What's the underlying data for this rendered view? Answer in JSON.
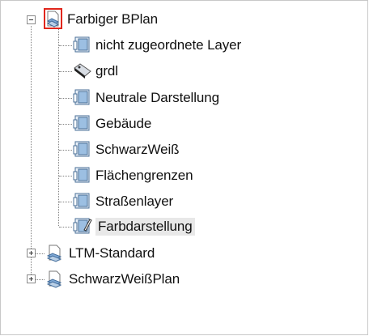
{
  "tree": {
    "root": {
      "label": "Farbiger BPlan",
      "icon": "plan-document-icon",
      "expanded": true,
      "children": [
        {
          "label": "nicht zugeordnete Layer",
          "icon": "layer-icon"
        },
        {
          "label": "grdl",
          "icon": "tag-icon"
        },
        {
          "label": "Neutrale Darstellung",
          "icon": "layer-icon"
        },
        {
          "label": "Gebäude",
          "icon": "layer-icon"
        },
        {
          "label": "SchwarzWeiß",
          "icon": "layer-icon"
        },
        {
          "label": "Flächengrenzen",
          "icon": "layer-icon"
        },
        {
          "label": "Straßenlayer",
          "icon": "layer-icon"
        },
        {
          "label": "Farbdarstellung",
          "icon": "layer-edit-icon",
          "selected": true
        }
      ]
    },
    "siblings": [
      {
        "label": "LTM-Standard",
        "icon": "plan-document-icon",
        "expanded": false
      },
      {
        "label": "SchwarzWeißPlan",
        "icon": "plan-document-icon",
        "expanded": false
      }
    ]
  }
}
